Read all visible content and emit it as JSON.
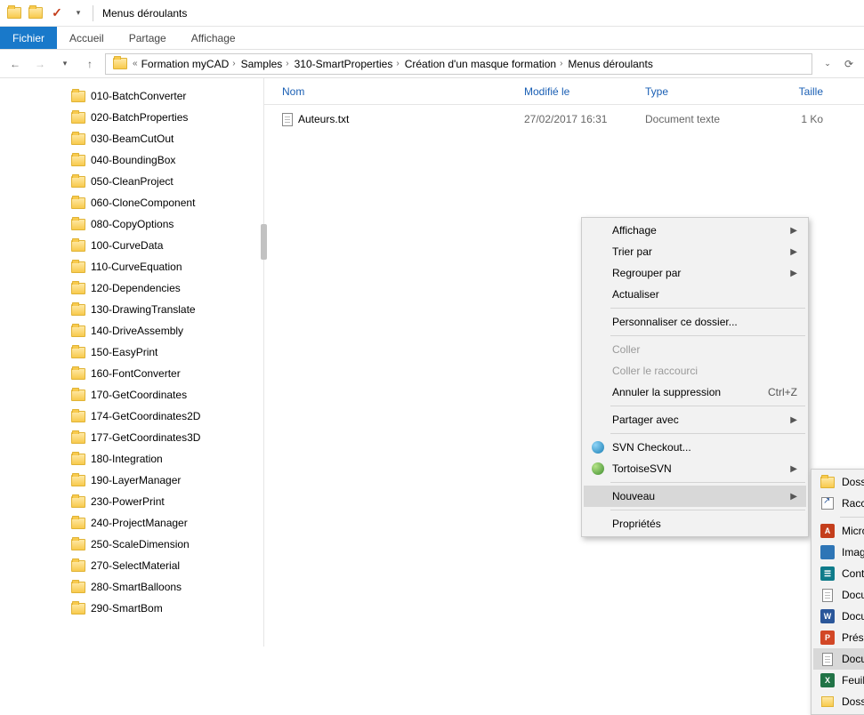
{
  "titlebar": {
    "title": "Menus déroulants"
  },
  "ribbon": {
    "file": "Fichier",
    "tabs": [
      "Accueil",
      "Partage",
      "Affichage"
    ]
  },
  "breadcrumb": {
    "items": [
      "Formation myCAD",
      "Samples",
      "310-SmartProperties",
      "Création d'un masque formation",
      "Menus déroulants"
    ]
  },
  "columns": {
    "name": "Nom",
    "modified": "Modifié le",
    "type": "Type",
    "size": "Taille"
  },
  "files": [
    {
      "name": "Auteurs.txt",
      "modified": "27/02/2017 16:31",
      "type": "Document texte",
      "size": "1 Ko"
    }
  ],
  "tree": [
    "010-BatchConverter",
    "020-BatchProperties",
    "030-BeamCutOut",
    "040-BoundingBox",
    "050-CleanProject",
    "060-CloneComponent",
    "080-CopyOptions",
    "100-CurveData",
    "110-CurveEquation",
    "120-Dependencies",
    "130-DrawingTranslate",
    "140-DriveAssembly",
    "150-EasyPrint",
    "160-FontConverter",
    "170-GetCoordinates",
    "174-GetCoordinates2D",
    "177-GetCoordinates3D",
    "180-Integration",
    "190-LayerManager",
    "230-PowerPrint",
    "240-ProjectManager",
    "250-ScaleDimension",
    "270-SelectMaterial",
    "280-SmartBalloons",
    "290-SmartBom"
  ],
  "ctx1": {
    "view": "Affichage",
    "sort": "Trier par",
    "group": "Regrouper par",
    "refresh": "Actualiser",
    "customize": "Personnaliser ce dossier...",
    "paste": "Coller",
    "paste_shortcut": "Coller le raccourci",
    "undo": "Annuler la suppression",
    "undo_sc": "Ctrl+Z",
    "share": "Partager avec",
    "svn_checkout": "SVN Checkout...",
    "tortoise": "TortoiseSVN",
    "new": "Nouveau",
    "properties": "Propriétés"
  },
  "ctx2": {
    "folder": "Dossier",
    "shortcut": "Raccourci",
    "access": "Microsoft Access Base de données",
    "bitmap": "Image bitmap",
    "contact": "Contact",
    "virtual": "Document virtuel",
    "word": "Document Microsoft Word",
    "ppt": "Présentation Microsoft PowerPoint",
    "text": "Document texte",
    "excel": "Feuille de calcul Microsoft Excel",
    "zip": "Dossier compressé"
  }
}
